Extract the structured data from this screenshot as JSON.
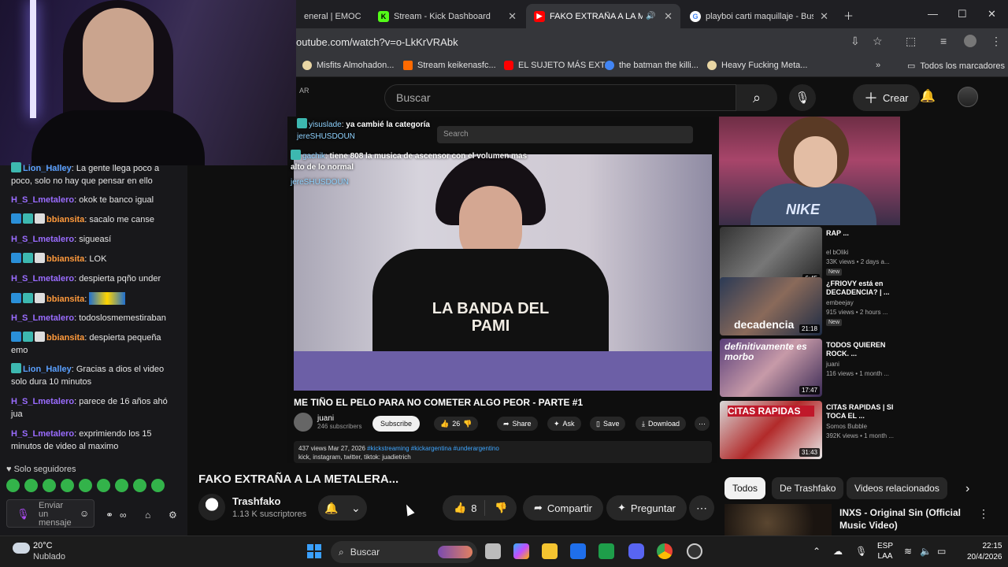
{
  "browser": {
    "tabs": [
      {
        "title": "eneral | EMOC",
        "icon": "tab-favicon"
      },
      {
        "title": "Stream - Kick Dashboard",
        "icon": "kick-icon"
      },
      {
        "title": "FAKO EXTRAÑA A LA METAL",
        "icon": "youtube-icon"
      },
      {
        "title": "playboi carti maquillaje - Busca",
        "icon": "google-icon"
      }
    ],
    "url": "outube.com/watch?v=o-LkKrVRAbk",
    "bookmarks": [
      "Misfits Almohadon...",
      "Stream keikenasfc...",
      "EL SUJETO MÁS EXT...",
      "the batman the killi...",
      "Heavy Fucking Meta...",
      "Todos los marcadores"
    ]
  },
  "youtube": {
    "country": "AR",
    "search_placeholder": "Buscar",
    "create_label": "Crear"
  },
  "chat": {
    "messages": [
      {
        "user": "Lion_Halley",
        "color": "#5aa0ff",
        "text": "La gente llega poco a poco, solo no hay que pensar en ello"
      },
      {
        "user": "H_S_Lmetalero",
        "color": "#9a6cff",
        "text": "okok te banco igual"
      },
      {
        "user": "bbiansita",
        "color": "#ff9a3c",
        "text": "sacalo me canse"
      },
      {
        "user": "H_S_Lmetalero",
        "color": "#9a6cff",
        "text": "sigueasí"
      },
      {
        "user": "bbiansita",
        "color": "#ff9a3c",
        "text": "LOK"
      },
      {
        "user": "H_S_Lmetalero",
        "color": "#9a6cff",
        "text": "despierta pqño under"
      },
      {
        "user": "bbiansita",
        "color": "#ff9a3c",
        "text": ""
      },
      {
        "user": "H_S_Lmetalero",
        "color": "#9a6cff",
        "text": "todoslosmemestiraban"
      },
      {
        "user": "bbiansita",
        "color": "#ff9a3c",
        "text": "despierta pequeña emo"
      },
      {
        "user": "Lion_Halley",
        "color": "#5aa0ff",
        "text": "Gracias a dios el video solo dura 10 minutos"
      },
      {
        "user": "H_S_Lmetalero",
        "color": "#9a6cff",
        "text": "parece de 16 años ahó jua"
      },
      {
        "user": "H_S_Lmetalero",
        "color": "#9a6cff",
        "text": "exprimiendo los 15 minutos de video al maximo"
      }
    ],
    "followers_only": "Solo seguidores",
    "input_placeholder": "Enviar un mensaje"
  },
  "inner_video": {
    "overlay_chat": [
      {
        "user": "yisuslade",
        "text": "ya cambié la categoría"
      },
      {
        "user": "jereSHUSDOUN",
        "text": ""
      },
      {
        "user": "gachik",
        "text": "tiene 808 la musica de ascensor con el volumen mas alto de lo normal"
      },
      {
        "user": "jereSHUSDOUN",
        "text": ""
      }
    ],
    "search_placeholder": "Search",
    "shirt_text": "LA BANDA DEL PAMI",
    "title": "ME TIÑO EL PELO PARA NO COMETER ALGO PEOR - PARTE #1",
    "channel": "juani",
    "subs": "246 subscribers",
    "subscribe": "Subscribe",
    "likes": "26",
    "share": "Share",
    "ask": "Ask",
    "save": "Save",
    "download": "Download",
    "views": "437 views  Mar 27, 2026",
    "tags": "#kickstreaming #kickargentina #underargentino",
    "desc": "kick, instagram, twitter, tiktok: juadietrich",
    "recs": [
      {
        "title": "RAP ...",
        "channel": "el bOliki",
        "meta": "33K views • 2 days a...",
        "dur": "6:45",
        "new": "New"
      },
      {
        "title": "¿FRIOVY está en DECADENCIA? | ...",
        "channel": "embeejay",
        "meta": "915 views • 2 hours ...",
        "dur": "21:18",
        "new": "New",
        "thumb_text": "decadencia"
      },
      {
        "title": "TODOS QUIEREN ROCK. ...",
        "channel": "juani",
        "meta": "116 views • 1 month ...",
        "dur": "17:47",
        "thumb_text": "definitivamente es morbo"
      },
      {
        "title": "CITAS RAPIDAS | SI TOCA EL ...",
        "channel": "Somos Bubble",
        "meta": "392K views • 1 month ...",
        "dur": "31:43",
        "thumb_text": "CITAS RAPIDAS"
      }
    ],
    "streamer_shirt": "NIKE"
  },
  "main": {
    "title": "FAKO EXTRAÑA A LA METALERA...",
    "channel": "Trashfako",
    "subs": "1.13 K suscriptores",
    "likes": "8",
    "share": "Compartir",
    "ask": "Preguntar",
    "chips": [
      "Todos",
      "De Trashfako",
      "Videos relacionados"
    ],
    "side_video_title": "INXS - Original Sin (Official Music Video)"
  },
  "taskbar": {
    "temp": "20°C",
    "weather": "Nublado",
    "search": "Buscar",
    "lang": "ESP",
    "lang2": "LAA",
    "time": "22:15",
    "date": "20/4/2026"
  }
}
